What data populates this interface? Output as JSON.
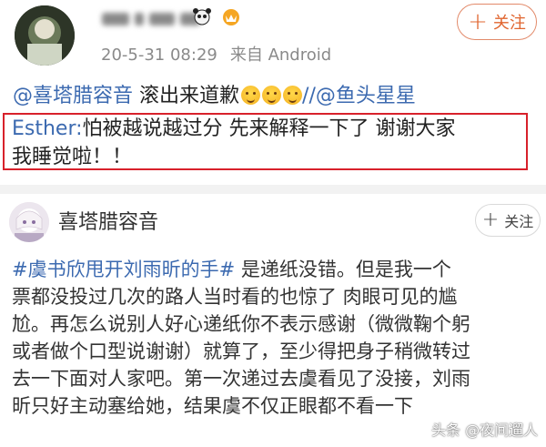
{
  "post1": {
    "name": "",
    "timestamp": "20-5-31 08:29",
    "source": "来自 Android",
    "follow_label": "关注",
    "line1_mention_a": "@喜塔腊容音",
    "line1_text": "滚出来道歉",
    "line1_mention_b": "//@鱼头星星",
    "quote_author": "Esther:",
    "quote_line1": "怕被越说越过分 先来解释一下了 谢谢大家",
    "quote_line2": "我睡觉啦！！",
    "emoji_icon": "emoji-sweat-smile-icon"
  },
  "post2": {
    "name": "喜塔腊容音",
    "follow_label": "关注",
    "hashtag": "#虞书欣甩开刘雨昕的手#",
    "lines": [
      "是递纸没错。但是我一个",
      "票都没投过几次的路人当时看的也惊了 肉眼可见的尴",
      "尬。再怎么说别人好心递纸你不表示感谢（微微鞠个躬",
      "或者做个口型说谢谢）就算了，至少得把身子稍微转过",
      "去一下面对人家吧。第一次递过去虞看见了没接，刘雨",
      "昕只好主动塞给她，结果虞不仅正眼都不看一下"
    ]
  },
  "watermark": "头条 @夜间遛人",
  "colors": {
    "accent": "#e0652f",
    "link": "#3c6ab0",
    "highlight_border": "#d8212b"
  }
}
